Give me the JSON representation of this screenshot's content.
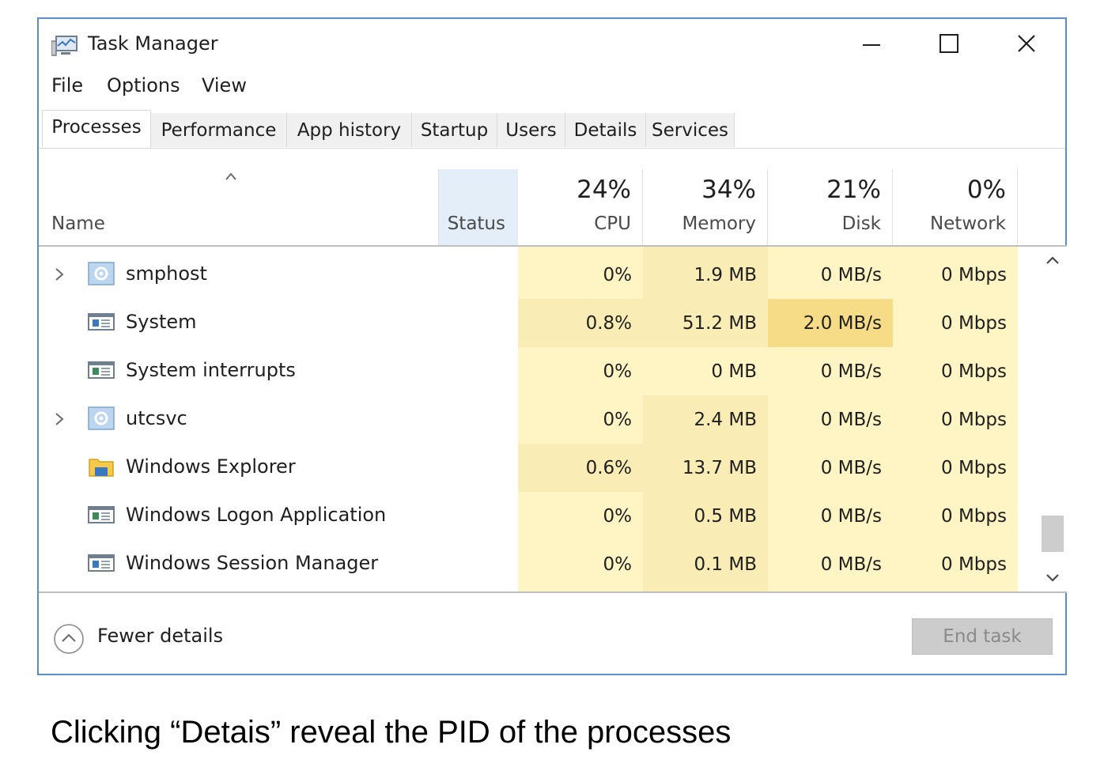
{
  "window": {
    "title": "Task Manager",
    "icon": "task-manager-icon"
  },
  "controls": {
    "minimize": "minimize-icon",
    "maximize": "maximize-icon",
    "close": "close-icon"
  },
  "menu": [
    "File",
    "Options",
    "View"
  ],
  "tabs": [
    {
      "label": "Processes",
      "active": true
    },
    {
      "label": "Performance",
      "active": false
    },
    {
      "label": "App history",
      "active": false
    },
    {
      "label": "Startup",
      "active": false
    },
    {
      "label": "Users",
      "active": false
    },
    {
      "label": "Details",
      "active": false
    },
    {
      "label": "Services",
      "active": false
    }
  ],
  "columns": {
    "name": "Name",
    "status": "Status",
    "cpu": {
      "percent": "24%",
      "label": "CPU"
    },
    "memory": {
      "percent": "34%",
      "label": "Memory"
    },
    "disk": {
      "percent": "21%",
      "label": "Disk"
    },
    "network": {
      "percent": "0%",
      "label": "Network"
    }
  },
  "processes": [
    {
      "name": "smphost",
      "icon": "service-gear-icon",
      "expandable": true,
      "cpu": "0%",
      "memory": "1.9 MB",
      "disk": "0 MB/s",
      "network": "0 Mbps"
    },
    {
      "name": "System",
      "icon": "system-window-icon",
      "expandable": false,
      "cpu": "0.8%",
      "memory": "51.2 MB",
      "disk": "2.0 MB/s",
      "network": "0 Mbps"
    },
    {
      "name": "System interrupts",
      "icon": "system-window-icon",
      "expandable": false,
      "cpu": "0%",
      "memory": "0 MB",
      "disk": "0 MB/s",
      "network": "0 Mbps"
    },
    {
      "name": "utcsvc",
      "icon": "service-gear-icon",
      "expandable": true,
      "cpu": "0%",
      "memory": "2.4 MB",
      "disk": "0 MB/s",
      "network": "0 Mbps"
    },
    {
      "name": "Windows Explorer",
      "icon": "folder-icon",
      "expandable": false,
      "cpu": "0.6%",
      "memory": "13.7 MB",
      "disk": "0 MB/s",
      "network": "0 Mbps"
    },
    {
      "name": "Windows Logon Application",
      "icon": "system-window-icon",
      "expandable": false,
      "cpu": "0%",
      "memory": "0.5 MB",
      "disk": "0 MB/s",
      "network": "0 Mbps"
    },
    {
      "name": "Windows Session Manager",
      "icon": "system-window-icon",
      "expandable": false,
      "cpu": "0%",
      "memory": "0.1 MB",
      "disk": "0 MB/s",
      "network": "0 Mbps"
    }
  ],
  "footer": {
    "fewer_details": "Fewer details",
    "end_task": "End task"
  },
  "caption": "Clicking “Detais” reveal the PID of the processes",
  "colors": {
    "window_border": "#5b8ec9",
    "heat_light": "#fff4c4",
    "heat_medium": "#f9ecb4",
    "heat_strong": "#f6dc86"
  }
}
